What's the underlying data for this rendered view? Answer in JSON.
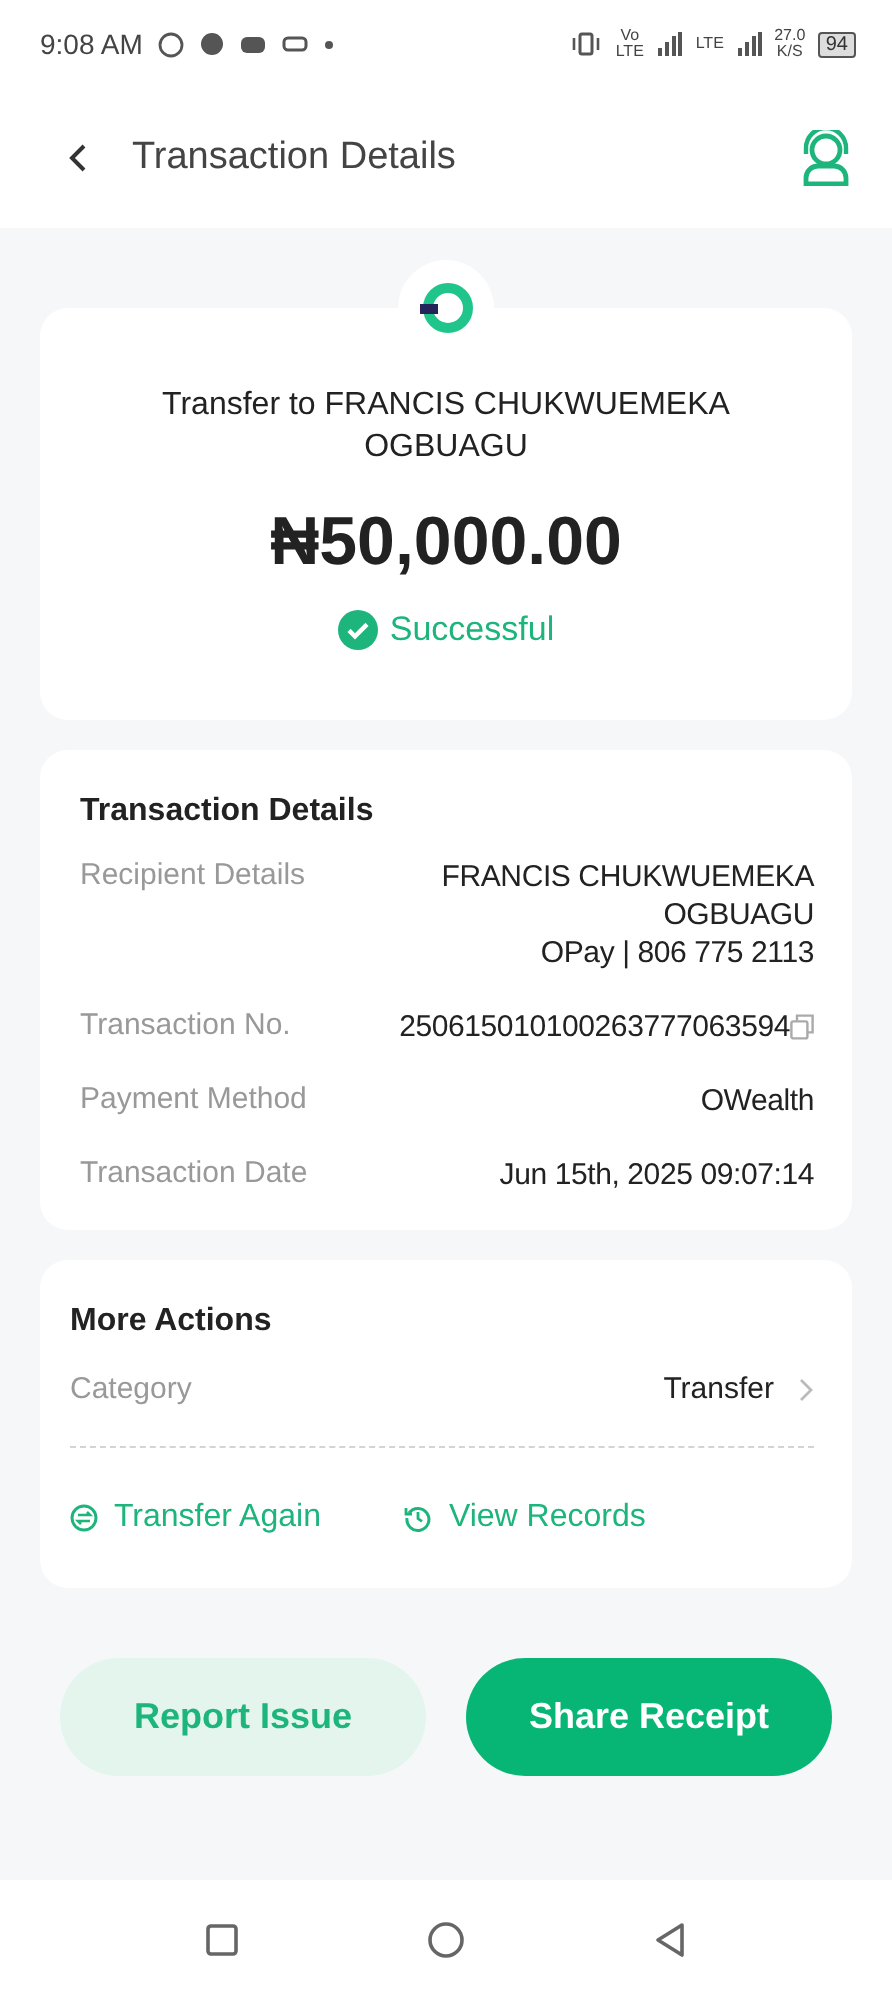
{
  "status_bar": {
    "time": "9:08 AM",
    "indicators": [
      "Vo LTE",
      "LTE",
      "27.0 K/S"
    ],
    "battery": "94"
  },
  "header": {
    "title": "Transaction Details"
  },
  "summary": {
    "title": "Transfer to FRANCIS CHUKWUEMEKA OGBUAGU",
    "amount": "₦50,000.00",
    "status": "Successful",
    "successful": true
  },
  "details": {
    "heading": "Transaction Details",
    "rows": [
      {
        "label": "Recipient Details",
        "value_lines": [
          "FRANCIS CHUKWUEMEKA",
          "OGBUAGU",
          "OPay | 806 775 2113"
        ],
        "copyable": false
      },
      {
        "label": "Transaction No.",
        "value_lines": [
          "250615010100263777063594"
        ],
        "copyable": true
      },
      {
        "label": "Payment Method",
        "value_lines": [
          "OWealth"
        ],
        "copyable": false
      },
      {
        "label": "Transaction Date",
        "value_lines": [
          "Jun 15th, 2025 09:07:14"
        ],
        "copyable": false
      }
    ]
  },
  "more_actions": {
    "heading": "More Actions",
    "category_label": "Category",
    "category_value": "Transfer",
    "actions": [
      {
        "label": "Transfer Again",
        "kind": "repeat"
      },
      {
        "label": "View Records",
        "kind": "history"
      }
    ]
  },
  "buttons": [
    {
      "label": "Report Issue",
      "kind": "secondary"
    },
    {
      "label": "Share Receipt",
      "kind": "primary"
    }
  ]
}
